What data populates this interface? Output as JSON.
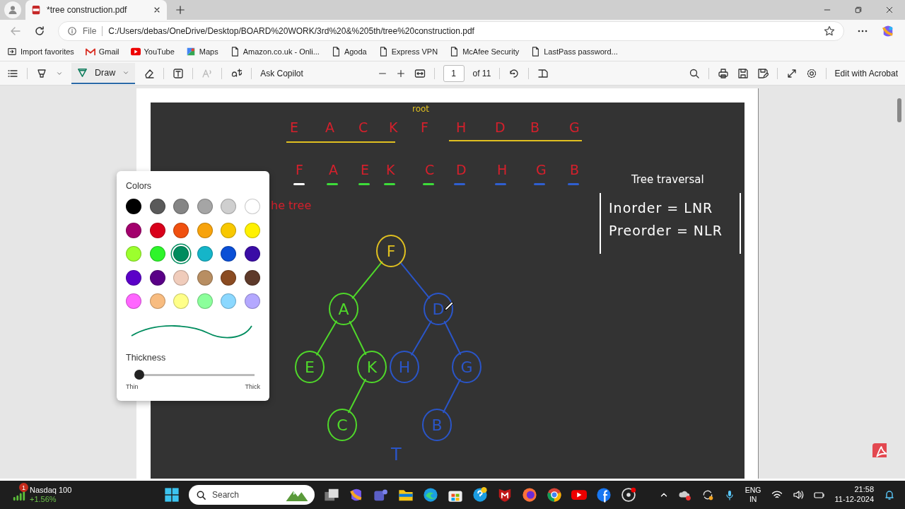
{
  "browser": {
    "tabs": [
      {
        "title": "*tree construction.pdf",
        "selected": true
      }
    ],
    "address": {
      "scheme": "File",
      "url": "C:/Users/debas/OneDrive/Desktop/BOARD%20WORK/3rd%20&%205th/tree%20construction.pdf"
    },
    "favorites": [
      {
        "label": "Import favorites",
        "kind": "import"
      },
      {
        "label": "Gmail",
        "kind": "mail"
      },
      {
        "label": "YouTube",
        "kind": "video"
      },
      {
        "label": "Maps",
        "kind": "map"
      },
      {
        "label": "Amazon.co.uk - Onli...",
        "kind": "page"
      },
      {
        "label": "Agoda",
        "kind": "page"
      },
      {
        "label": "Express VPN",
        "kind": "page"
      },
      {
        "label": "McAfee Security",
        "kind": "page"
      },
      {
        "label": "LastPass password...",
        "kind": "page"
      }
    ]
  },
  "pdf_toolbar": {
    "draw": {
      "label": "Draw",
      "selected": true
    },
    "ask": "Ask Copilot",
    "page": "1",
    "page_count": "of 11",
    "edit": "Edit with Acrobat"
  },
  "color_picker": {
    "title": "Colors",
    "swatches": [
      {
        "color": "#000000",
        "selected": false
      },
      {
        "color": "#5a5a5a",
        "selected": false
      },
      {
        "color": "#858585",
        "selected": false
      },
      {
        "color": "#a5a5a5",
        "selected": false
      },
      {
        "color": "#cfcfcf",
        "selected": false
      },
      {
        "color": "#ffffff",
        "selected": false
      },
      {
        "color": "#a3006d",
        "selected": false
      },
      {
        "color": "#d9001b",
        "selected": false
      },
      {
        "color": "#f0500f",
        "selected": false
      },
      {
        "color": "#f7a30c",
        "selected": false
      },
      {
        "color": "#f8c800",
        "selected": false
      },
      {
        "color": "#fff100",
        "selected": false
      },
      {
        "color": "#9cff2d",
        "selected": false
      },
      {
        "color": "#2ef52b",
        "selected": false
      },
      {
        "color": "#008c5e",
        "selected": true
      },
      {
        "color": "#15b5c9",
        "selected": false
      },
      {
        "color": "#0a4fd6",
        "selected": false
      },
      {
        "color": "#3a0ca6",
        "selected": false
      },
      {
        "color": "#5b00c8",
        "selected": false
      },
      {
        "color": "#5a0087",
        "selected": false
      },
      {
        "color": "#f0ccbb",
        "selected": false
      },
      {
        "color": "#b88e62",
        "selected": false
      },
      {
        "color": "#8b4c22",
        "selected": false
      },
      {
        "color": "#5e3a2a",
        "selected": false
      },
      {
        "color": "#ff66ff",
        "selected": false
      },
      {
        "color": "#f8bc80",
        "selected": false
      },
      {
        "color": "#ffff88",
        "selected": false
      },
      {
        "color": "#8bff9b",
        "selected": false
      },
      {
        "color": "#8bd8ff",
        "selected": false
      },
      {
        "color": "#b4a8ff",
        "selected": false
      }
    ],
    "thickness": {
      "title": "Thickness",
      "level": 0.03,
      "min_label": "Thin",
      "max_label": "Thick"
    }
  },
  "board": {
    "root_label": "root",
    "inorder": [
      "E",
      "A",
      "C",
      "K",
      "F",
      "H",
      "D",
      "B",
      "G"
    ],
    "preorder": [
      {
        "text": "F",
        "color": "#ffffff"
      },
      {
        "text": "A",
        "color": "#3ddc3a"
      },
      {
        "text": "E",
        "color": "#3ddc3a"
      },
      {
        "text": "K",
        "color": "#3ddc3a"
      },
      {
        "text": "C",
        "color": "#3ddc3a"
      },
      {
        "text": "D",
        "color": "#2f5fd0"
      },
      {
        "text": "H",
        "color": "#2f5fd0"
      },
      {
        "text": "G",
        "color": "#2f5fd0"
      },
      {
        "text": "B",
        "color": "#2f5fd0"
      }
    ],
    "partial_note": "he tree",
    "traversal_title": "Tree traversal",
    "traversal_rules": [
      "Inorder = LNR",
      "Preorder = NLR"
    ],
    "tree": {
      "label": "F",
      "color": "#e0c020",
      "children": [
        {
          "label": "A",
          "color": "#4fd82a",
          "children": [
            {
              "label": "E",
              "color": "#4fd82a"
            },
            {
              "label": "K",
              "color": "#4fd82a",
              "children": [
                {
                  "label": "C",
                  "color": "#4fd82a"
                }
              ]
            }
          ]
        },
        {
          "label": "D",
          "color": "#2a55c8",
          "children": [
            {
              "label": "H",
              "color": "#2a55c8"
            },
            {
              "label": "G",
              "color": "#2a55c8",
              "children": [
                {
                  "label": "B",
                  "color": "#2a55c8"
                }
              ]
            }
          ]
        }
      ]
    },
    "stray_letter": "T"
  },
  "taskbar": {
    "widget": {
      "badge": "1",
      "title": "Nasdaq 100",
      "change": "+1.56%"
    },
    "search": "Search",
    "language": "ENG",
    "region": "IN",
    "time": "21:58",
    "date": "11-12-2024"
  }
}
